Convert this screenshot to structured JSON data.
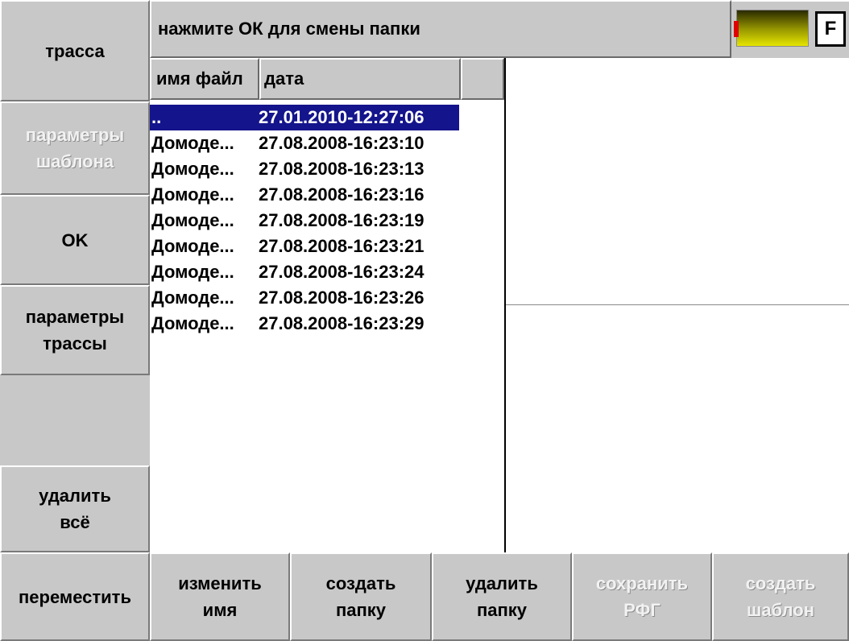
{
  "status": {
    "message": "нажмите ОК для смены папки",
    "f_label": "F"
  },
  "left_menu": {
    "trace": "трасса",
    "template_params_1": "параметры",
    "template_params_2": "шаблона",
    "ok": "OK",
    "trace_params_1": "параметры",
    "trace_params_2": "трассы",
    "delete_all_1": "удалить",
    "delete_all_2": "всё"
  },
  "file_list": {
    "columns": [
      "имя файл",
      "дата"
    ],
    "rows": [
      {
        "name": "..",
        "date": "27.01.2010-12:27:06",
        "selected": true
      },
      {
        "name": "Домоде...",
        "date": "27.08.2008-16:23:10"
      },
      {
        "name": "Домоде...",
        "date": "27.08.2008-16:23:13"
      },
      {
        "name": "Домоде...",
        "date": "27.08.2008-16:23:16"
      },
      {
        "name": "Домоде...",
        "date": "27.08.2008-16:23:19"
      },
      {
        "name": "Домоде...",
        "date": "27.08.2008-16:23:21"
      },
      {
        "name": "Домоде...",
        "date": "27.08.2008-16:23:24"
      },
      {
        "name": "Домоде...",
        "date": "27.08.2008-16:23:26"
      },
      {
        "name": "Домоде...",
        "date": "27.08.2008-16:23:29"
      }
    ]
  },
  "bottom_menu": {
    "move": "переместить",
    "rename_1": "изменить",
    "rename_2": "имя",
    "create_folder_1": "создать",
    "create_folder_2": "папку",
    "delete_folder_1": "удалить",
    "delete_folder_2": "папку",
    "save_rfg_1": "сохранить",
    "save_rfg_2": "РФГ",
    "create_template_1": "создать",
    "create_template_2": "шаблон"
  },
  "colors": {
    "button_bg": "#c8c8c8",
    "selection": "#14148c",
    "battery_yellow": "#e6e600",
    "battery_red": "#e00000"
  }
}
